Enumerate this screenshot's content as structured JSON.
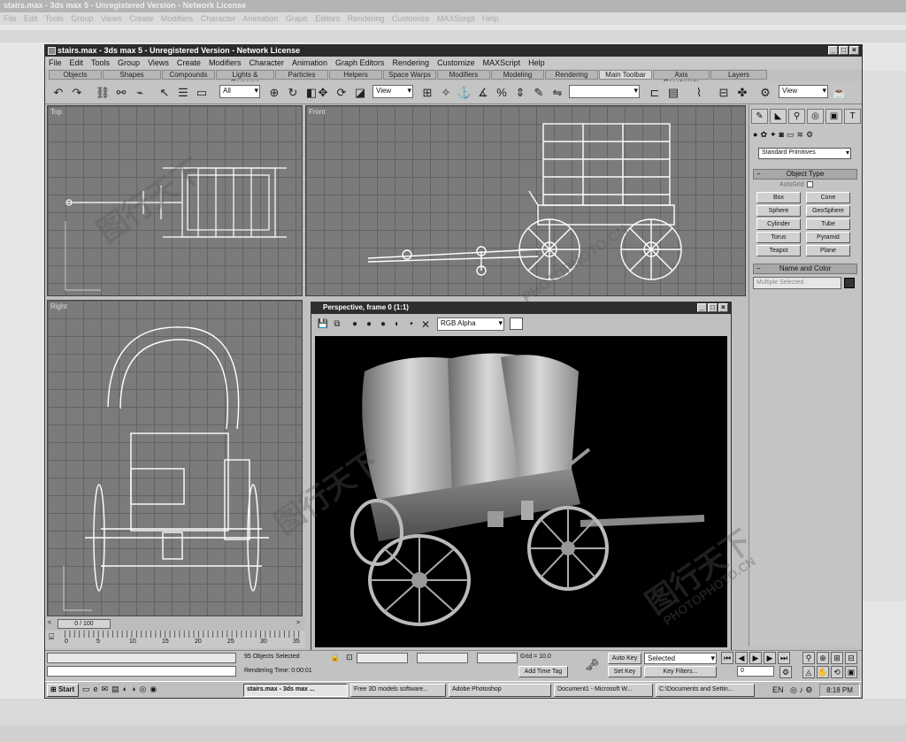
{
  "background": {
    "title": "stairs.max - 3ds max 5 - Unregistered Version - Network License",
    "menu": "File Edit Tools Group Views Create Modifiers Character Animation Graph Editors Rendering Customize MAXScript Help"
  },
  "window": {
    "title": "stairs.max - 3ds max 5 - Unregistered Version - Network License",
    "menu": [
      "File",
      "Edit",
      "Tools",
      "Group",
      "Views",
      "Create",
      "Modifiers",
      "Character",
      "Animation",
      "Graph Editors",
      "Rendering",
      "Customize",
      "MAXScript",
      "Help"
    ],
    "tabs": [
      "Objects",
      "Shapes",
      "Compounds",
      "Lights & Cameras",
      "Particles",
      "Helpers",
      "Space Warps",
      "Modifiers",
      "Modeling",
      "Rendering",
      "Main Toolbar",
      "Axis Constraints",
      "Layers"
    ],
    "selected_tab": "Main Toolbar",
    "toolbar": {
      "selection_filter": "All",
      "ref_coord": "View",
      "ref_coord2": "View"
    }
  },
  "viewports": {
    "top": "Top",
    "front": "Front",
    "right": "Right"
  },
  "render_window": {
    "title": "Perspective, frame 0 (1:1)",
    "channel": "RGB Alpha"
  },
  "command_panel": {
    "category": "Standard Primitives",
    "object_type_header": "Object Type",
    "autogrid": "AutoGrid",
    "buttons": [
      "Box",
      "Cone",
      "Sphere",
      "GeoSphere",
      "Cylinder",
      "Tube",
      "Torus",
      "Pyramid",
      "Teapot",
      "Plane"
    ],
    "name_color_header": "Name and Color",
    "name_field": "Multiple Selected"
  },
  "timeline": {
    "slider": "0 / 100",
    "ticks": [
      "0",
      "5",
      "10",
      "15",
      "20",
      "25",
      "30",
      "35"
    ]
  },
  "status": {
    "selected": "95 Objects Selected",
    "rendering_time": "Rendering Time: 0:00:01",
    "grid": "Grid = 10.0",
    "add_time_tag": "Add Time Tag",
    "auto_key": "Auto Key",
    "set_key": "Set Key",
    "selected_dd": "Selected",
    "key_filters": "Key Filters...",
    "frame": "0"
  },
  "taskbar": {
    "start": "Start",
    "tasks": [
      "stairs.max - 3ds max ...",
      "Free 3D models software...",
      "Adobe Photoshop",
      "Document1 - Microsoft W...",
      "C:\\Documents and Settin..."
    ],
    "clock": "8:18 PM"
  },
  "watermark": {
    "cn": "图行天下",
    "en": "PHOTOPHOTO.CN"
  }
}
